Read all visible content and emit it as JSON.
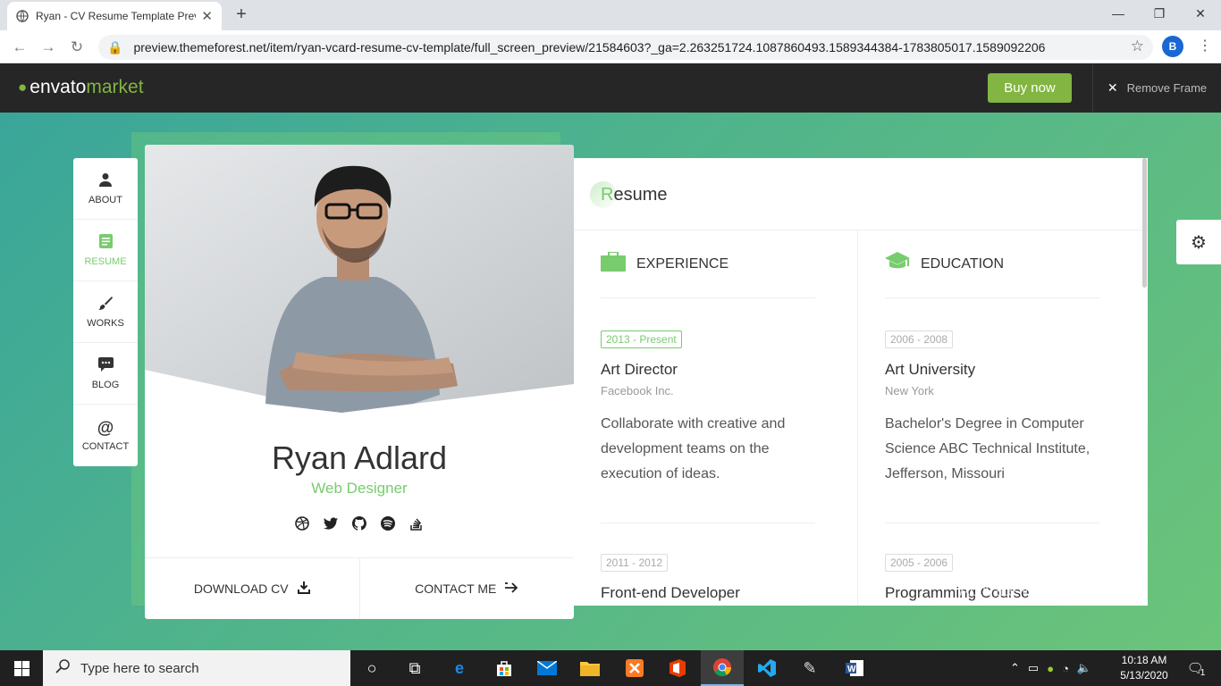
{
  "browser": {
    "tab_title": "Ryan - CV Resume Template Preview",
    "new_tab": "+",
    "url": "preview.themeforest.net/item/ryan-vcard-resume-cv-template/full_screen_preview/21584603?_ga=2.263251724.1087860493.1589344384-1783805017.1589092206",
    "profile_initial": "B"
  },
  "envato": {
    "logo_envato": "envato",
    "logo_market": "market",
    "buy_label": "Buy now",
    "remove_label": "Remove Frame"
  },
  "sidenav": {
    "items": [
      {
        "label": "ABOUT",
        "icon": "user-icon"
      },
      {
        "label": "RESUME",
        "icon": "document-icon"
      },
      {
        "label": "WORKS",
        "icon": "brush-icon"
      },
      {
        "label": "BLOG",
        "icon": "chat-icon"
      },
      {
        "label": "CONTACT",
        "icon": "at-icon"
      }
    ],
    "active": "RESUME"
  },
  "profile": {
    "name": "Ryan Adlard",
    "role": "Web Designer",
    "socials": [
      "dribbble-icon",
      "twitter-icon",
      "github-icon",
      "spotify-icon",
      "stackoverflow-icon"
    ],
    "download_label": "DOWNLOAD CV",
    "contact_label": "CONTACT ME"
  },
  "resume": {
    "title_first": "R",
    "title_rest": "esume",
    "experience": {
      "heading": "EXPERIENCE",
      "entries": [
        {
          "dates": "2013 - Present",
          "title": "Art Director",
          "org": "Facebook Inc.",
          "desc": "Collaborate with creative and development teams on the execution of ideas."
        },
        {
          "dates": "2011 - 2012",
          "title": "Front-end Developer"
        }
      ]
    },
    "education": {
      "heading": "EDUCATION",
      "entries": [
        {
          "dates": "2006 - 2008",
          "title": "Art University",
          "org": "New York",
          "desc": "Bachelor's Degree in Computer Science ABC Technical Institute, Jefferson, Missouri"
        },
        {
          "dates": "2005 - 2006",
          "title": "Programming Course"
        }
      ]
    }
  },
  "watermark": "Activate Windows",
  "taskbar": {
    "search_placeholder": "Type here to search",
    "time": "10:18 AM",
    "date": "5/13/2020",
    "notification_count": "1"
  },
  "colors": {
    "accent": "#78cc6d",
    "envato_green": "#82b541",
    "envato_bar": "#262626"
  }
}
